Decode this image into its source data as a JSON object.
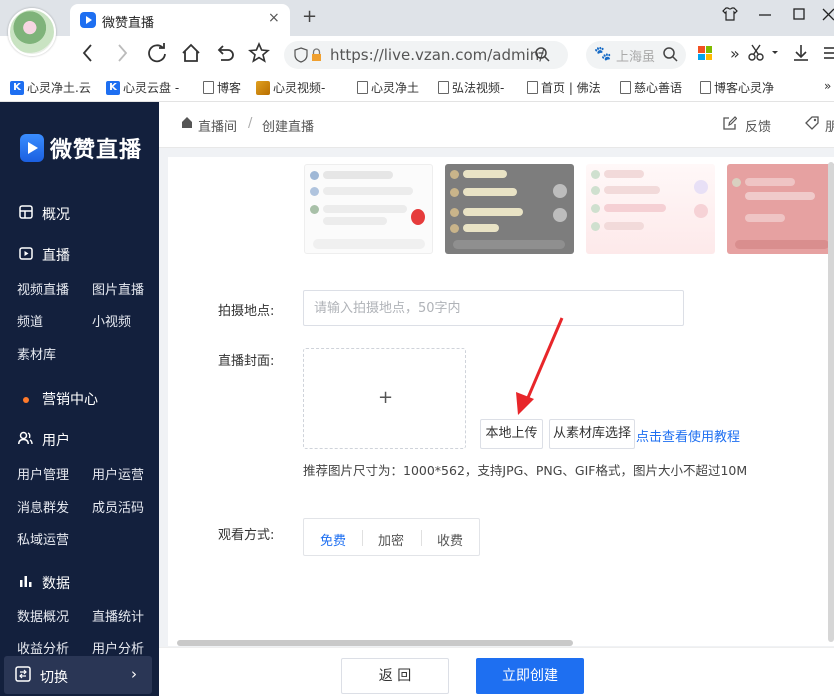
{
  "browser": {
    "tab_title": "微赞直播",
    "tab_close": "×",
    "new_tab": "+",
    "url": "https://live.vzan.com/admin/",
    "search_placeholder": "上海虽",
    "toolbar_more": "»",
    "bookmarks": [
      {
        "label": "心灵净土.云",
        "icon": "k-icon"
      },
      {
        "label": "心灵云盘 -",
        "icon": "k-icon"
      },
      {
        "label": "博客",
        "icon": "doc-icon"
      },
      {
        "label": "心灵视频-",
        "icon": "gold-icon"
      },
      {
        "label": "心灵净土",
        "icon": "doc-icon"
      },
      {
        "label": "弘法视频-",
        "icon": "doc-icon"
      },
      {
        "label": "首页 | 佛法",
        "icon": "doc-icon"
      },
      {
        "label": "慈心善语",
        "icon": "doc-icon"
      },
      {
        "label": "博客心灵净",
        "icon": "doc-icon"
      }
    ],
    "bookmark_more": "»"
  },
  "sidebar": {
    "logo": "微赞直播",
    "sections": [
      {
        "label": "概况",
        "icon": "dashboard-icon"
      },
      {
        "label": "直播",
        "icon": "live-icon"
      },
      {
        "label": "营销中心",
        "icon": "dot-icon"
      },
      {
        "label": "用户",
        "icon": "users-icon"
      },
      {
        "label": "数据",
        "icon": "chart-icon"
      }
    ],
    "live_items": [
      "视频直播",
      "图片直播",
      "频道",
      "小视频",
      "素材库"
    ],
    "user_items": [
      "用户管理",
      "用户运营",
      "消息群发",
      "成员活码",
      "私域运营"
    ],
    "data_items": [
      "数据概况",
      "直播统计",
      "收益分析",
      "用户分析"
    ],
    "switch_label": "切换",
    "switch_arrow": "›"
  },
  "header": {
    "breadcrumb_home": "直播间",
    "breadcrumb_sep": "/",
    "breadcrumb_current": "创建直播",
    "feedback": "反馈",
    "more_text": "朋"
  },
  "form": {
    "location_label": "拍摄地点:",
    "location_placeholder": "请输入拍摄地点，50字内",
    "location_value": "",
    "cover_label": "直播封面:",
    "cover_plus": "+",
    "local_upload": "本地上传",
    "library_select": "从素材库选择",
    "tutorial_link": "点击查看使用教程",
    "size_hint": "推荐图片尺寸为：1000*562，支持JPG、PNG、GIF格式，图片大小不超过10M",
    "watch_label": "观看方式:",
    "watch_options": [
      "免费",
      "加密",
      "收费"
    ],
    "watch_selected": "免费"
  },
  "footer": {
    "back": "返 回",
    "create": "立即创建"
  },
  "colors": {
    "sidebar_bg": "#13203d",
    "accent": "#1e6ff1",
    "arrow": "#e8262a"
  }
}
